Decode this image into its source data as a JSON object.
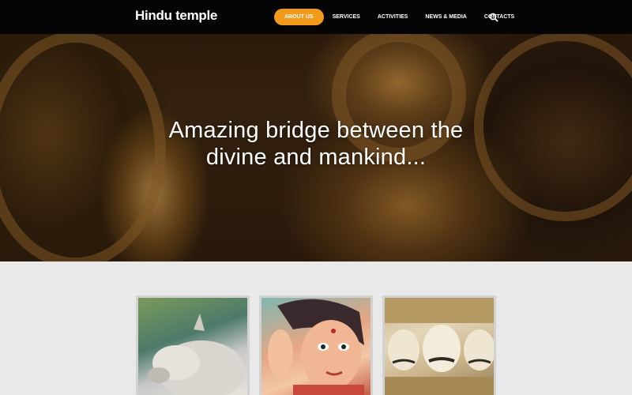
{
  "header": {
    "logo": "Hindu temple",
    "nav": [
      {
        "label": "ABOUT US",
        "active": true
      },
      {
        "label": "SERVICES",
        "active": false
      },
      {
        "label": "ACTIVITIES",
        "active": false
      },
      {
        "label": "NEWS & MEDIA",
        "active": false
      },
      {
        "label": "CONTACTS",
        "active": false
      }
    ],
    "search_icon": "search-icon"
  },
  "hero": {
    "title_line1": "Amazing bridge between the",
    "title_line2": "divine and mankind..."
  },
  "gallery": [
    {
      "subject": "white bull statue"
    },
    {
      "subject": "painted goddess statue"
    },
    {
      "subject": "multi-headed deity statue"
    }
  ],
  "colors": {
    "accent": "#f29a1a",
    "header_bg": "#050505",
    "page_bg": "#e9e9e9",
    "text_light": "#ffffff"
  }
}
